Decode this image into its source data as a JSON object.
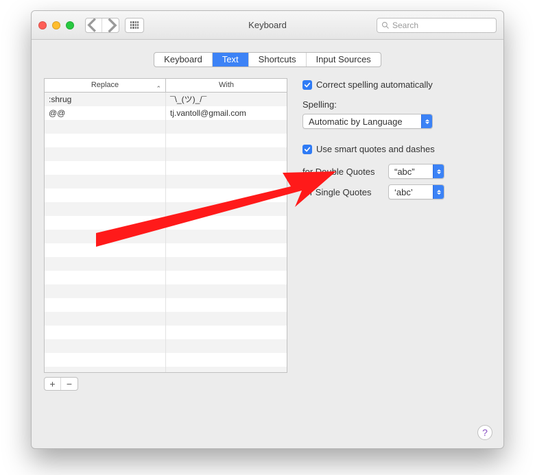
{
  "window": {
    "title": "Keyboard"
  },
  "search": {
    "placeholder": "Search"
  },
  "tabs": [
    {
      "label": "Keyboard",
      "active": false
    },
    {
      "label": "Text",
      "active": true
    },
    {
      "label": "Shortcuts",
      "active": false
    },
    {
      "label": "Input Sources",
      "active": false
    }
  ],
  "table": {
    "headers": {
      "replace": "Replace",
      "with": "With"
    },
    "rows": [
      {
        "replace": ":shrug",
        "with": "¯\\_(ツ)_/¯"
      },
      {
        "replace": "@@",
        "with": "tj.vantoll@gmail.com"
      }
    ]
  },
  "options": {
    "correctSpelling": {
      "label": "Correct spelling automatically",
      "checked": true
    },
    "spellingLabel": "Spelling:",
    "spellingValue": "Automatic by Language",
    "smartQuotes": {
      "label": "Use smart quotes and dashes",
      "checked": true
    },
    "doubleQuotes": {
      "label": "for Double Quotes",
      "value": "“abc”"
    },
    "singleQuotes": {
      "label": "for Single Quotes",
      "value": "‘abc’"
    }
  },
  "buttons": {
    "add": "+",
    "remove": "−"
  },
  "help": "?"
}
